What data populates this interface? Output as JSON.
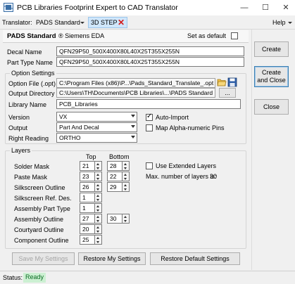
{
  "window": {
    "title": "PCB Libraries Footprint Expert to CAD Translator",
    "minimize": "—",
    "maximize": "☐",
    "close": "✕"
  },
  "menubar": {
    "translator_label": "Translator:",
    "translator_value": "PADS Standard",
    "tab_label": "3D STEP",
    "tab_close": "✕",
    "help_label": "Help"
  },
  "header": {
    "cad_name": "PADS Standard",
    "vendor": "® Siemens EDA",
    "default_label": "Set as default",
    "default_checked": false
  },
  "fields": {
    "decal_label": "Decal Name",
    "decal_value": "QFN29P50_500X400X80L40X25T355X255N",
    "part_type_label": "Part Type Name",
    "part_type_value": "QFN29P50_500X400X80L40X25T355X255N"
  },
  "options": {
    "caption": "Option Settings",
    "option_file_label": "Option File (.opt)",
    "option_file_value": "C:\\Program Files (x86)\\P...\\Pads_Standard_Translate_.opt",
    "output_dir_label": "Output Directory",
    "output_dir_value": "C:\\Users\\TH\\Documents\\PCB Libraries\\...\\PADS Standard",
    "library_label": "Library Name",
    "library_value": "PCB_Libraries",
    "version_label": "Version",
    "version_value": "VX",
    "output_label": "Output",
    "output_value": "Part And Decal",
    "right_reading_label": "Right Reading",
    "right_reading_value": "ORTHO",
    "auto_import_label": "Auto-Import",
    "auto_import_checked": true,
    "map_alpha_label": "Map Alpha-numeric Pins",
    "map_alpha_checked": false,
    "browse_label": "..."
  },
  "layers": {
    "caption": "Layers",
    "top_header": "Top",
    "bottom_header": "Bottom",
    "use_extended_label": "Use Extended Layers",
    "use_extended_checked": false,
    "max_label": "Max. number of layers is:",
    "max_value": "30",
    "rows": [
      {
        "name": "Solder Mask",
        "top": "21",
        "bottom": "28"
      },
      {
        "name": "Paste Mask",
        "top": "23",
        "bottom": "22"
      },
      {
        "name": "Silkscreen Outline",
        "top": "26",
        "bottom": "29"
      },
      {
        "name": "Silkscreen Ref. Des.",
        "top": "1",
        "bottom": ""
      },
      {
        "name": "Assembly Part Type",
        "top": "1",
        "bottom": ""
      },
      {
        "name": "Assembly Outline",
        "top": "27",
        "bottom": "30"
      },
      {
        "name": "Courtyard Outline",
        "top": "20",
        "bottom": ""
      },
      {
        "name": "Component Outline",
        "top": "25",
        "bottom": ""
      }
    ]
  },
  "buttons": {
    "save": "Save My Settings",
    "restore": "Restore My Settings",
    "restore_default": "Restore Default Settings",
    "create": "Create",
    "create_close": "Create and Close",
    "close": "Close"
  },
  "status": {
    "label": "Status:",
    "value": "Ready"
  },
  "colors": {
    "accent": "#3c7fb1",
    "tab_bg": "#cfe6fb",
    "ready_bg": "#ccf0d2",
    "close_x": "#d41a1a"
  }
}
